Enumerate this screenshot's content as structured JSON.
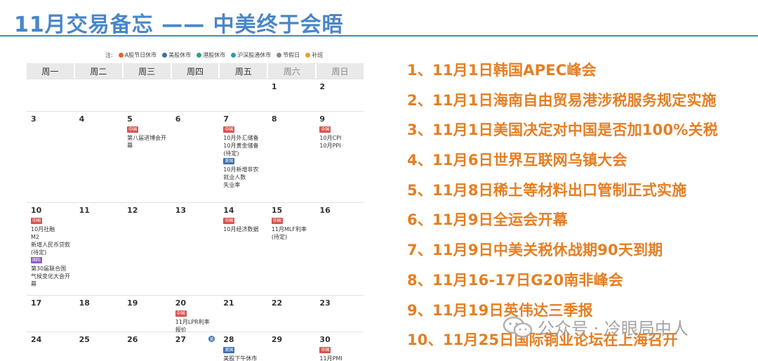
{
  "title": "11月交易备忘 —— 中美终于会晤",
  "calendar": {
    "legend": [
      {
        "label": "注:",
        "color": ""
      },
      {
        "label": "A股节日休市",
        "color": "#e8622a"
      },
      {
        "label": "美股休市",
        "color": "#3a6fb0"
      },
      {
        "label": "港股休市",
        "color": "#2aa37a"
      },
      {
        "label": "沪深股通休市",
        "color": "#2a9bb8"
      },
      {
        "label": "节假日",
        "color": "#888888"
      },
      {
        "label": "补班",
        "color": "#e8a22a"
      }
    ],
    "weekdays": [
      "周一",
      "周二",
      "周三",
      "周四",
      "周五",
      "周六",
      "周日"
    ],
    "weeks": [
      [
        {
          "n": ""
        },
        {
          "n": ""
        },
        {
          "n": ""
        },
        {
          "n": ""
        },
        {
          "n": ""
        },
        {
          "n": "1"
        },
        {
          "n": "2"
        }
      ],
      [
        {
          "n": "3"
        },
        {
          "n": "4"
        },
        {
          "n": "5",
          "items": [
            {
              "tag": "中国",
              "kind": "cn"
            },
            {
              "text": "第八届进博会开幕"
            }
          ]
        },
        {
          "n": "6"
        },
        {
          "n": "7",
          "items": [
            {
              "tag": "中国",
              "kind": "cn"
            },
            {
              "text": "10月外汇储备"
            },
            {
              "text": "10月黄金储备(待定)"
            },
            {
              "tag": "美国",
              "kind": "us"
            },
            {
              "text": "10月新增非农就业人数"
            },
            {
              "text": "失业率"
            }
          ]
        },
        {
          "n": "8"
        },
        {
          "n": "9",
          "items": [
            {
              "tag": "中国",
              "kind": "cn"
            },
            {
              "text": "10月CPI"
            },
            {
              "text": "10月PPI"
            }
          ]
        }
      ],
      [
        {
          "n": "10",
          "items": [
            {
              "tag": "中国",
              "kind": "cn"
            },
            {
              "text": "10月社融"
            },
            {
              "text": "M2"
            },
            {
              "text": "新增人民币贷款(待定)"
            },
            {
              "tag": "国际",
              "kind": "intl"
            },
            {
              "text": "第30届联合国气候变化大会开幕"
            }
          ]
        },
        {
          "n": "11"
        },
        {
          "n": "12"
        },
        {
          "n": "13"
        },
        {
          "n": "14",
          "items": [
            {
              "tag": "中国",
              "kind": "cn"
            },
            {
              "text": "10月经济数据"
            }
          ]
        },
        {
          "n": "15",
          "items": [
            {
              "tag": "中国",
              "kind": "cn"
            },
            {
              "text": "11月MLF利率(待定)"
            }
          ]
        },
        {
          "n": "16"
        }
      ],
      [
        {
          "n": "17"
        },
        {
          "n": "18"
        },
        {
          "n": "19"
        },
        {
          "n": "20",
          "items": [
            {
              "tag": "中国",
              "kind": "cn"
            },
            {
              "text": "11月LPR利率报价"
            }
          ]
        },
        {
          "n": "21"
        },
        {
          "n": "22"
        },
        {
          "n": "23"
        }
      ],
      [
        {
          "n": "24"
        },
        {
          "n": "25"
        },
        {
          "n": "26"
        },
        {
          "n": "27",
          "mark": "美"
        },
        {
          "n": "28",
          "items": [
            {
              "tag": "美国",
              "kind": "us"
            },
            {
              "text": "美股下午休市"
            }
          ]
        },
        {
          "n": "29"
        },
        {
          "n": "30",
          "items": [
            {
              "tag": "中国",
              "kind": "cn"
            },
            {
              "text": "11月PMI"
            }
          ]
        }
      ]
    ]
  },
  "events": [
    "1、11月1日韩国APEC峰会",
    "2、11月1日海南自由贸易港涉税服务规定实施",
    "3、11月1日美国决定对中国是否加100%关税",
    "4、11月6日世界互联网乌镇大会",
    "5、11月8日稀土等材料出口管制正式实施",
    "6、11月9日全运会开幕",
    "7、11月9日中美关税休战期90天到期",
    "8、11月16-17日G20南非峰会",
    "9、11月19日英伟达三季报",
    "10、11月25日国际铜业论坛在上海召开"
  ],
  "watermark": "公众号 · 冷眼局中人"
}
